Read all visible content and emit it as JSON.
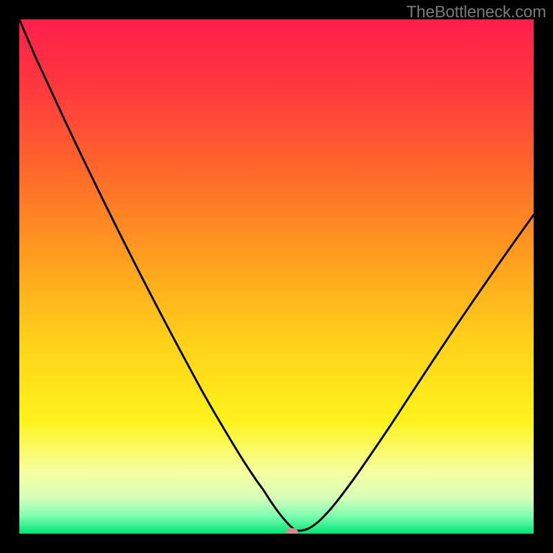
{
  "watermark": "TheBottleneck.com",
  "chart_data": {
    "type": "line",
    "title": "",
    "xlabel": "",
    "ylabel": "",
    "xlim": [
      0,
      100
    ],
    "ylim": [
      0,
      100
    ],
    "grid": false,
    "legend": false,
    "background": {
      "type": "vertical-gradient",
      "stops": [
        {
          "pos": 0.0,
          "color": "#ff1f4b"
        },
        {
          "pos": 0.14,
          "color": "#ff3a3e"
        },
        {
          "pos": 0.3,
          "color": "#ff6a2a"
        },
        {
          "pos": 0.48,
          "color": "#ffa31e"
        },
        {
          "pos": 0.62,
          "color": "#ffcf1a"
        },
        {
          "pos": 0.78,
          "color": "#fff31c"
        },
        {
          "pos": 0.88,
          "color": "#f6ffa0"
        },
        {
          "pos": 0.93,
          "color": "#d6ffb8"
        },
        {
          "pos": 0.965,
          "color": "#7fffb0"
        },
        {
          "pos": 1.0,
          "color": "#00e477"
        }
      ]
    },
    "series": [
      {
        "name": "bottleneck-curve",
        "color": "#000000",
        "x": [
          0.0,
          3,
          6,
          9,
          12,
          15,
          18,
          21,
          24,
          27,
          30,
          33,
          36,
          39,
          42,
          44,
          46,
          47.5,
          49,
          50.5,
          52,
          53,
          54,
          56,
          58,
          60,
          62,
          65,
          68,
          72,
          76,
          80,
          85,
          90,
          95,
          100
        ],
        "y": [
          100,
          93,
          86.5,
          80,
          73.7,
          67.5,
          61.4,
          55.4,
          49.5,
          43.7,
          38.0,
          32.4,
          26.9,
          21.7,
          16.7,
          13.5,
          10.5,
          8.4,
          6.1,
          4.0,
          2.2,
          1.2,
          0.6,
          0.9,
          2.2,
          4.2,
          6.6,
          10.6,
          14.9,
          20.8,
          26.9,
          33.0,
          40.5,
          47.8,
          55.0,
          62.0
        ]
      }
    ],
    "marker": {
      "name": "optimal-point",
      "x": 53,
      "y": 0.3,
      "color": "#d48a8f",
      "rx": 9,
      "ry": 6
    }
  }
}
